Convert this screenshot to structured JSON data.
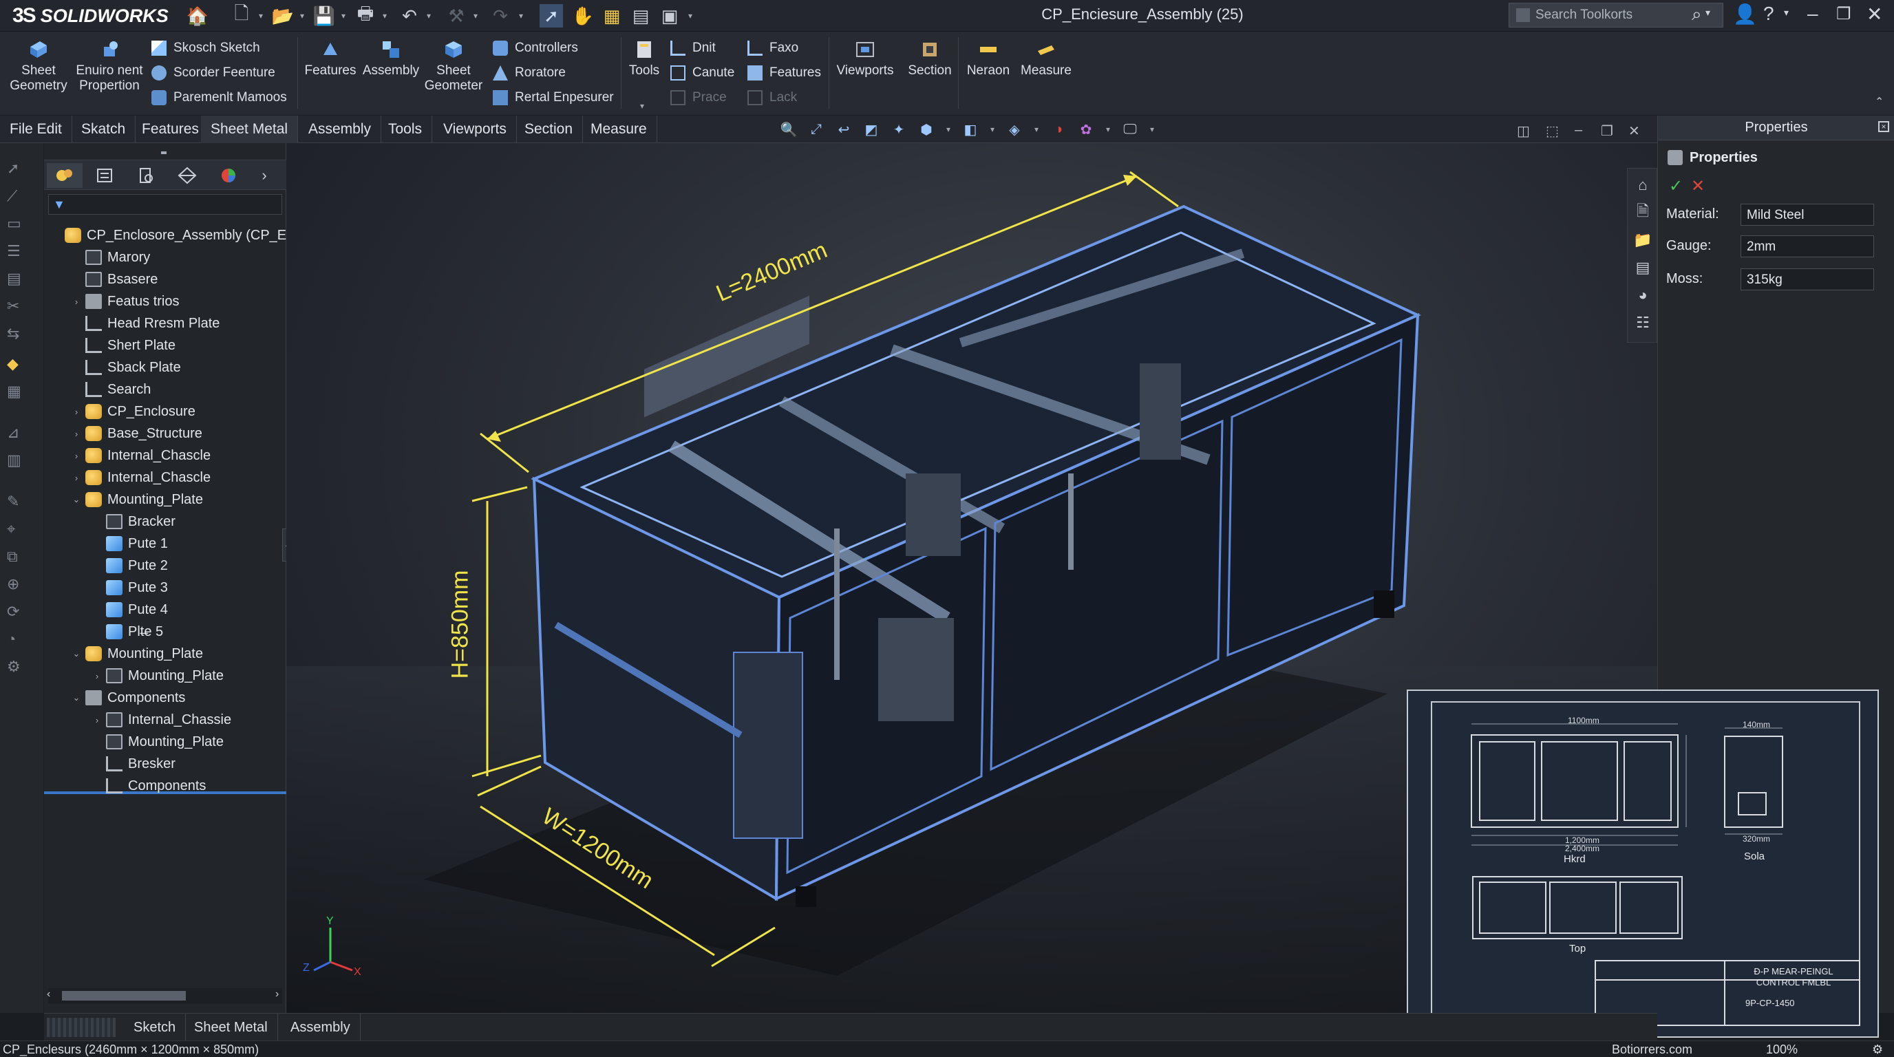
{
  "app": {
    "brand": "SOLIDWORKS",
    "brand_prefix": "3S",
    "title": "CP_Enciesure_Assembly (25)",
    "search_placeholder": "Search Toolkorts"
  },
  "ribbon": {
    "sheet_geometry": "Sheet\nGeometry",
    "environment": "Enuiro nent\nPropertion",
    "sketch": "Skosch Sketch",
    "scorder": "Scorder Feenture",
    "paremenlt": "Paremenlt Mamoos",
    "features": "Features",
    "assembly": "Assembly",
    "sheet_geometer": "Sheet\nGeometer",
    "controllers": "Controllers",
    "roratore": "Roratore",
    "rertal": "Rertal Enpesurer",
    "tools": "Tools",
    "dnit": "Dnit",
    "canute": "Canute",
    "prace": "Prace",
    "faxo": "Faxo",
    "features2": "Features",
    "lack": "Lack",
    "viewports": "Viewports",
    "section": "Section",
    "neraon": "Neraon",
    "measure": "Measure"
  },
  "tabs": [
    "File Edit",
    "Skatch",
    "Features",
    "Sheet Metal",
    "Assembly",
    "Tools",
    "Viewports",
    "Section",
    "Measure"
  ],
  "tree": {
    "root": "CP_Enclosore_Assembly (CP_Enclos",
    "items": [
      "Marory",
      "Bsasere",
      "Featus trios",
      "Head Rresm Plate",
      "Shert Plate",
      "Sback Plate",
      "Search",
      "CP_Enclosure",
      "Base_Structure",
      "Internal_Chascle",
      "Internal_Chascle",
      "Mounting_Plate",
      "Bracker",
      "Pute 1",
      "Pute 2",
      "Pute 3",
      "Pute 4",
      "Plt̶e 5",
      "Mounting_Plate",
      "Mounting_Plate",
      "Components",
      "Internal_Chassie",
      "Mounting_Plate",
      "Bresker",
      "Components"
    ]
  },
  "viewport": {
    "dim_length": "L=2400mm",
    "dim_height": "H=850mm",
    "dim_width": "W=1200mm",
    "axis_x": "X",
    "axis_y": "Y",
    "axis_z": "Z"
  },
  "properties": {
    "title": "Properties",
    "section": "Properties",
    "material_label": "Material:",
    "material_value": "Mild Steel",
    "gauge_label": "Gauge:",
    "gauge_value": "2mm",
    "mass_label": "Moss:",
    "mass_value": "315kg"
  },
  "drawing": {
    "dim_top": "1100mm",
    "dim_bottom": "1,200mm",
    "dim_bottom2": "2,400mm",
    "front_label": "Hkrd",
    "side_label": "Sola",
    "top_label": "Top",
    "side_dim": "140mm",
    "side_dim2": "320mm",
    "tb_title": "Ð-P MEAR-PEINGL CONTROL FMLBL",
    "tb_num": "9P-CP-1450"
  },
  "bottom_tabs": [
    "Sketch",
    "Sheet Metal",
    "Assembly"
  ],
  "status": {
    "left": "CP_Enclesurs (2460mm × 1200mm × 850mm)",
    "right": "Botiorrers.com",
    "zoom": "100%"
  }
}
